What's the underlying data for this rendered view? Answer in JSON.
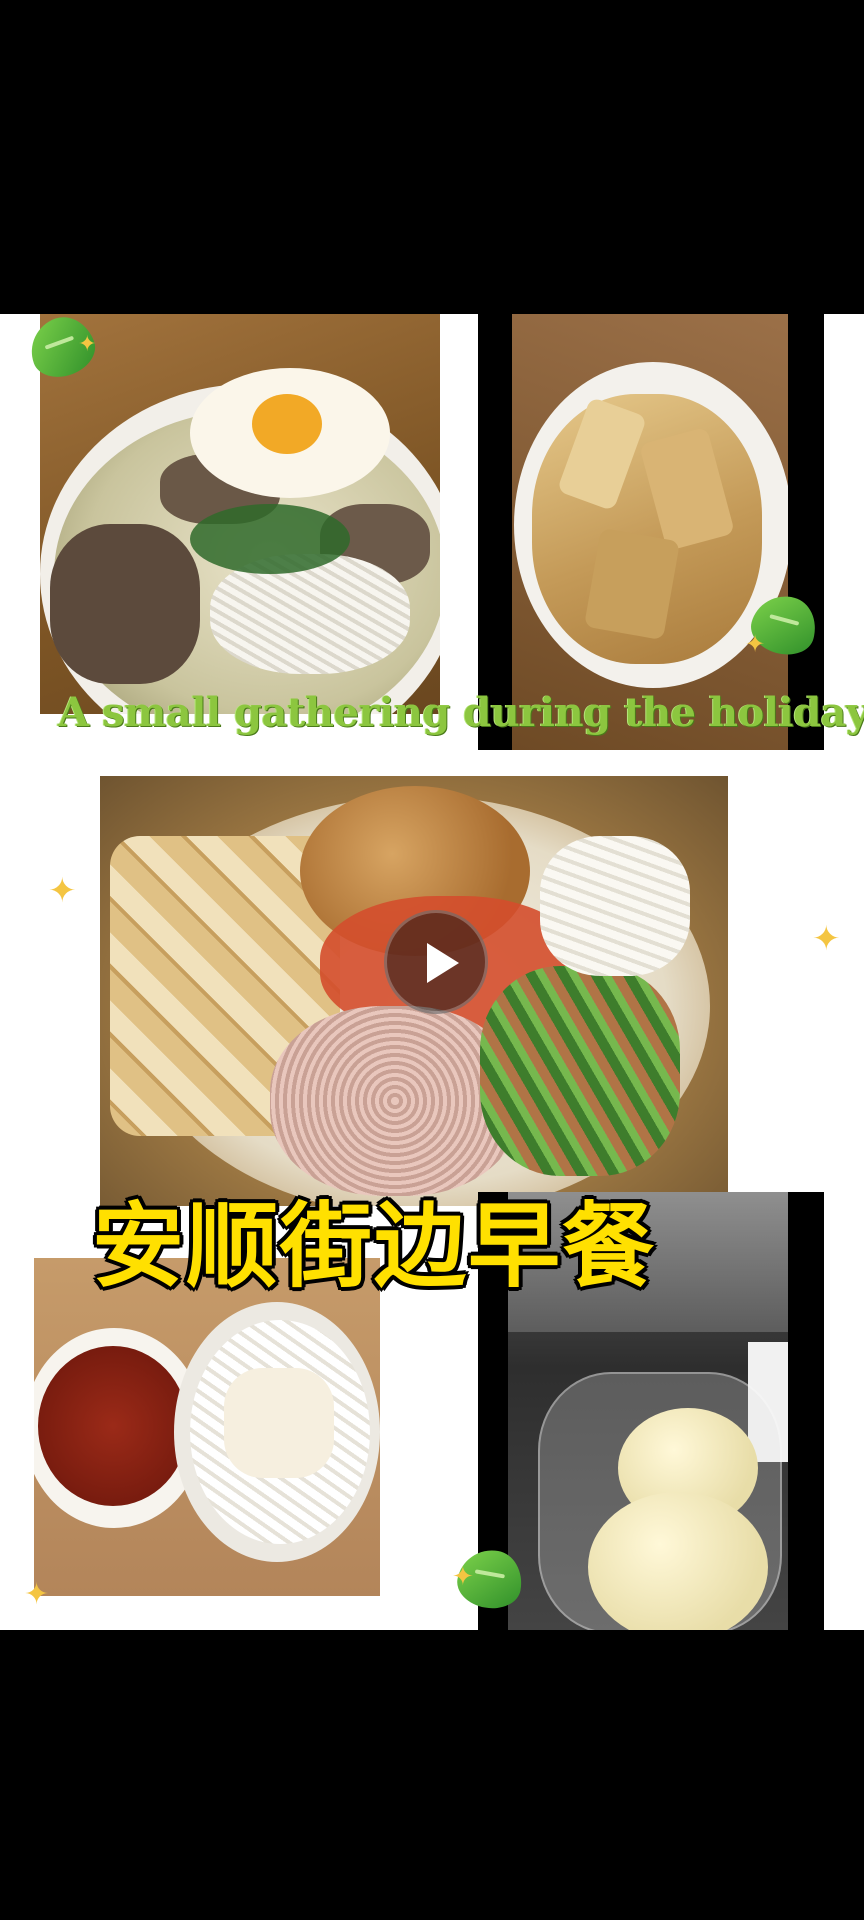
{
  "overlay": {
    "english_caption": "A small gathering during the holiday",
    "chinese_title": "安顺街边早餐"
  },
  "icons": {
    "play": "play-icon",
    "sticker": "leaf-sticker-icon",
    "sparkle": "sparkle-icon"
  },
  "colors": {
    "background": "#000000",
    "canvas": "#ffffff",
    "caption_green": "#8cc63f",
    "title_yellow": "#ffe000"
  },
  "sparkle_glyph": "✦"
}
